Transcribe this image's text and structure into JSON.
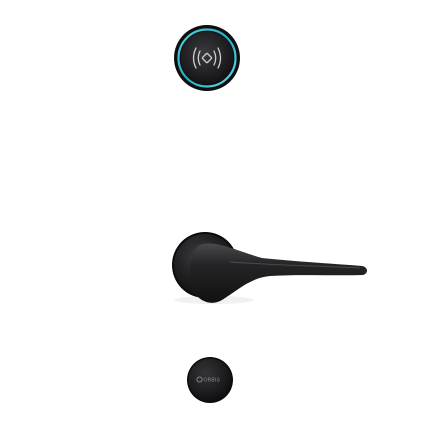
{
  "product": {
    "reader": {
      "icon": "rfid-contactless-icon",
      "ring_color": "#35c6d8",
      "body_color": "#1b1b1d"
    },
    "handle": {
      "icon": "lever-handle",
      "body_color": "#1f1f21"
    },
    "thumbturn": {
      "icon": "brand-logo-icon",
      "brand_text": "ORBIS",
      "body_color": "#1d1d1f"
    }
  }
}
